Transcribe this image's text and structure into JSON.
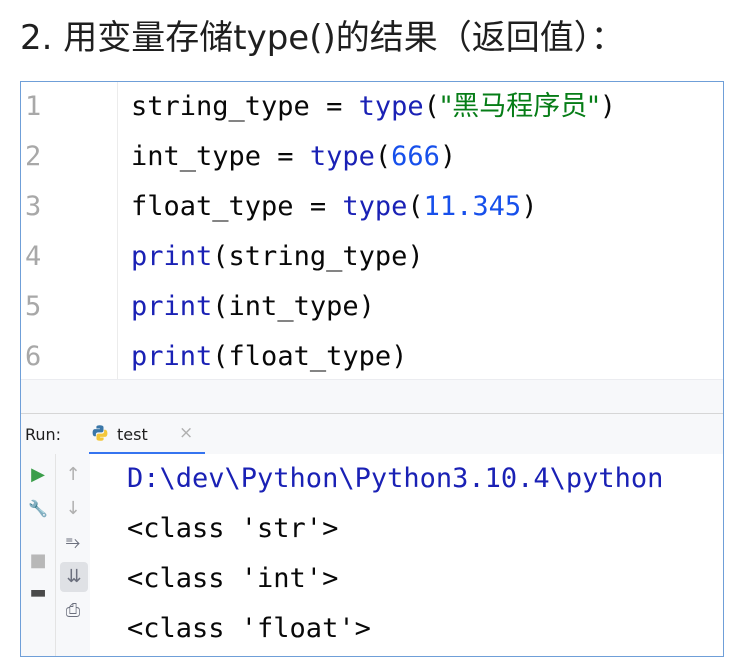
{
  "heading": "2. 用变量存储type()的结果（返回值）：",
  "editor": {
    "lines": [
      {
        "num": "1",
        "var": "string_type",
        "eq": " = ",
        "fn": "type",
        "open": "(",
        "arg": "\"黑马程序员\"",
        "close": ")"
      },
      {
        "num": "2",
        "var": "int_type",
        "eq": " = ",
        "fn": "type",
        "open": "(",
        "arg": "666",
        "close": ")"
      },
      {
        "num": "3",
        "var": "float_type",
        "eq": " = ",
        "fn": "type",
        "open": "(",
        "arg": "11.345",
        "close": ")"
      },
      {
        "num": "4",
        "fn": "print",
        "open": "(",
        "arg": "string_type",
        "close": ")"
      },
      {
        "num": "5",
        "fn": "print",
        "open": "(",
        "arg": "int_type",
        "close": ")"
      },
      {
        "num": "6",
        "fn": "print",
        "open": "(",
        "arg": "float_type",
        "close": ")"
      }
    ]
  },
  "run_panel": {
    "label": "Run:",
    "tab_label": "test",
    "tab_close": "×",
    "toolbar": {
      "rerun_icon": "▶",
      "settings_icon": "🔧",
      "stop_icon": "■",
      "layout_icon": "▬",
      "up_icon": "↑",
      "down_icon": "↓",
      "softwrap_icon": "⥱",
      "scroll_end_icon": "⇊",
      "print_icon": "⎙"
    },
    "output": [
      "D:\\dev\\Python\\Python3.10.4\\python",
      "<class 'str'>",
      "<class 'int'>",
      "<class 'float'>"
    ]
  },
  "colors": {
    "keyword": "#1a21b5",
    "number": "#1750eb",
    "string": "#067d17",
    "line_number": "#a8a8a8",
    "frame_border": "#6f9fd8",
    "tab_underline": "#3574f0"
  }
}
